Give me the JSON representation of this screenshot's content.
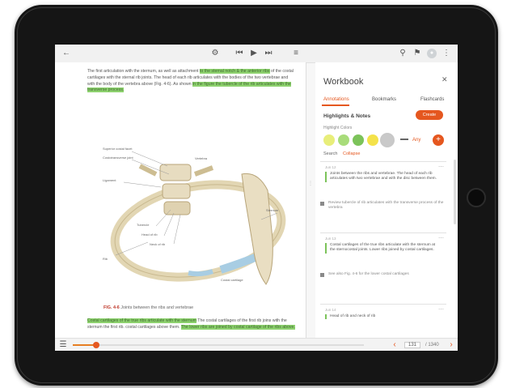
{
  "colors": {
    "accent": "#e5571f",
    "highlight_green": "#8ed26f",
    "device_bezel": "#151515"
  },
  "topbar": {
    "left_icon": "back-arrow-icon",
    "center_icons": [
      "settings-icon",
      "skip-back-icon",
      "play-icon",
      "skip-forward-icon",
      "list-icon"
    ],
    "right_icons": [
      "search-icon",
      "bookmark-icon",
      "user-avatar",
      "more-icon"
    ]
  },
  "reader": {
    "para1_plain": "The first articulation with the sternum, as well as attachment",
    "para1_hl1": "to the sternal notch & the anterior ribs",
    "para2_plain": "of the costal cartilages with the sternal rib joints. The head of each rib",
    "para3_plain": "articulates with the bodies of the two vertebrae and with the body of the vertebra",
    "para4_plain": "above (Fig. 4-6). As shown",
    "para4_hl": "in the figure the tubercle of the rib articulates with the",
    "para5_hl": "transverse process.",
    "caption_label": "FIG. 4-6",
    "caption_text": "Joints between the ribs and vertebrae",
    "bottom_hl1": "Costal cartilages of the true ribs articulate with the sternum",
    "bottom_plain1": "The costal cartilages of the first rib joins with the sternum the first rib.",
    "bottom_plain2": "costal cartilages above them.",
    "bottom_hl2": "The lower ribs are joined by costal cartilage of the ribs above."
  },
  "figure_labels": [
    "Superior costal facet",
    "Costotransverse joint",
    "Ligament",
    "Tubercle",
    "Head of rib",
    "Neck of rib",
    "Costal cartilage",
    "Sternum",
    "Vertebra",
    "Rib"
  ],
  "bottombar": {
    "progress": 0.08,
    "page_label": "131",
    "page_total": "/ 1340",
    "left_icon": "toc-icon"
  },
  "workbook": {
    "title": "Workbook",
    "close_icon": "close-icon",
    "tabs": [
      "Annotations",
      "Bookmarks",
      "Flashcards"
    ],
    "section_title": "Highlights & Notes",
    "create_button": "Create",
    "colors_label": "Highlight Colors",
    "swatches": [
      "#e8ee7a",
      "#a8dc7a",
      "#7cc35a",
      "#f4e24a",
      "#c9c9c9"
    ],
    "swatch_text": "Any",
    "tool_labels": [
      "Search",
      "Collapse"
    ],
    "notes": [
      {
        "date": "Jun 12",
        "text": "Joints between the ribs and vertebrae. The head of each rib articulates with two vertebrae and with the disc between them.",
        "sub": "Review tubercle of rib articulates with the transverse process of the vertebra"
      },
      {
        "date": "Jun 13",
        "text": "Costal cartilages of the true ribs articulate with the sternum at the sternocostal joints. Lower ribs joined by costal cartilages.",
        "sub": "See also Fig. 4-6 for the lower costal cartilages"
      },
      {
        "date": "Jun 14",
        "text": "Head of rib and neck of rib",
        "sub": ""
      }
    ]
  }
}
